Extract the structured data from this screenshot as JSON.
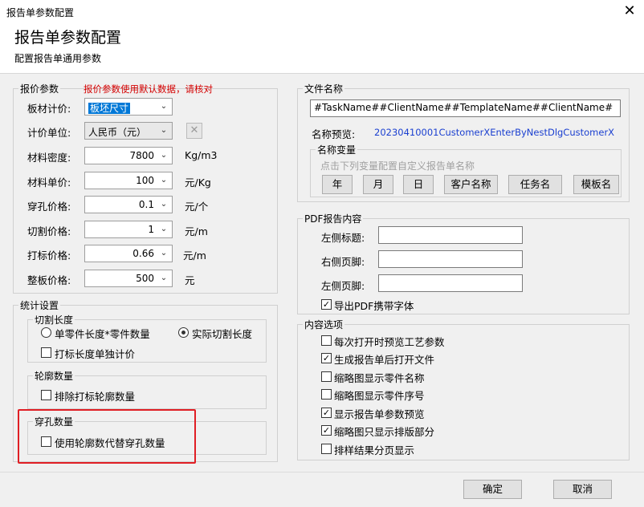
{
  "window": {
    "title": "报告单参数配置",
    "close": "✕"
  },
  "header": {
    "title": "报告单参数配置",
    "subtitle": "配置报告单通用参数"
  },
  "price": {
    "legend": "报价参数",
    "warning": "报价参数使用默认数据，请核对",
    "board": {
      "label": "板材计价:",
      "value": "板坯尺寸"
    },
    "unit": {
      "label": "计价单位:",
      "value": "人民币（元）"
    },
    "density": {
      "label": "材料密度:",
      "value": "7800",
      "unit": "Kg/m3"
    },
    "unit_price": {
      "label": "材料单价:",
      "value": "100",
      "unit": "元/Kg"
    },
    "pierce": {
      "label": "穿孔价格:",
      "value": "0.1",
      "unit": "元/个"
    },
    "cut": {
      "label": "切割价格:",
      "value": "1",
      "unit": "元/m"
    },
    "mark": {
      "label": "打标价格:",
      "value": "0.66",
      "unit": "元/m"
    },
    "sheet": {
      "label": "整板价格:",
      "value": "500",
      "unit": "元"
    }
  },
  "stats": {
    "legend": "统计设置",
    "cutlen": {
      "legend": "切割长度",
      "radio1": "单零件长度*零件数量",
      "radio2": "实际切割长度",
      "check": "打标长度单独计价"
    },
    "contour": {
      "legend": "轮廓数量",
      "check": "排除打标轮廓数量"
    },
    "holes": {
      "legend": "穿孔数量",
      "check": "使用轮廓数代替穿孔数量"
    }
  },
  "filename": {
    "legend": "文件名称",
    "value": "#TaskName##ClientName##TemplateName##ClientName#",
    "preview_label": "名称预览:",
    "preview_value": "20230410001CustomerXEnterByNestDlgCustomerX",
    "vars": {
      "legend": "名称变量",
      "hint": "点击下列变量配置自定义报告单名称",
      "buttons": [
        "年",
        "月",
        "日",
        "客户名称",
        "任务名",
        "模板名"
      ]
    }
  },
  "pdf": {
    "legend": "PDF报告内容",
    "left_title": "左侧标题:",
    "right_footer": "右侧页脚:",
    "left_footer": "左侧页脚:",
    "embed_font": "导出PDF携带字体"
  },
  "content": {
    "legend": "内容选项",
    "items": [
      {
        "label": "每次打开时预览工艺参数",
        "checked": false
      },
      {
        "label": "生成报告单后打开文件",
        "checked": true
      },
      {
        "label": "缩略图显示零件名称",
        "checked": false
      },
      {
        "label": "缩略图显示零件序号",
        "checked": false
      },
      {
        "label": "显示报告单参数预览",
        "checked": true
      },
      {
        "label": "缩略图只显示排版部分",
        "checked": true
      },
      {
        "label": "排样结果分页显示",
        "checked": false
      }
    ]
  },
  "footer": {
    "ok": "确定",
    "cancel": "取消"
  },
  "colors": {
    "warning": "#d40000",
    "preview": "#1a3fd0",
    "highlight_box": "#e01e24",
    "selection": "#0078d7"
  }
}
